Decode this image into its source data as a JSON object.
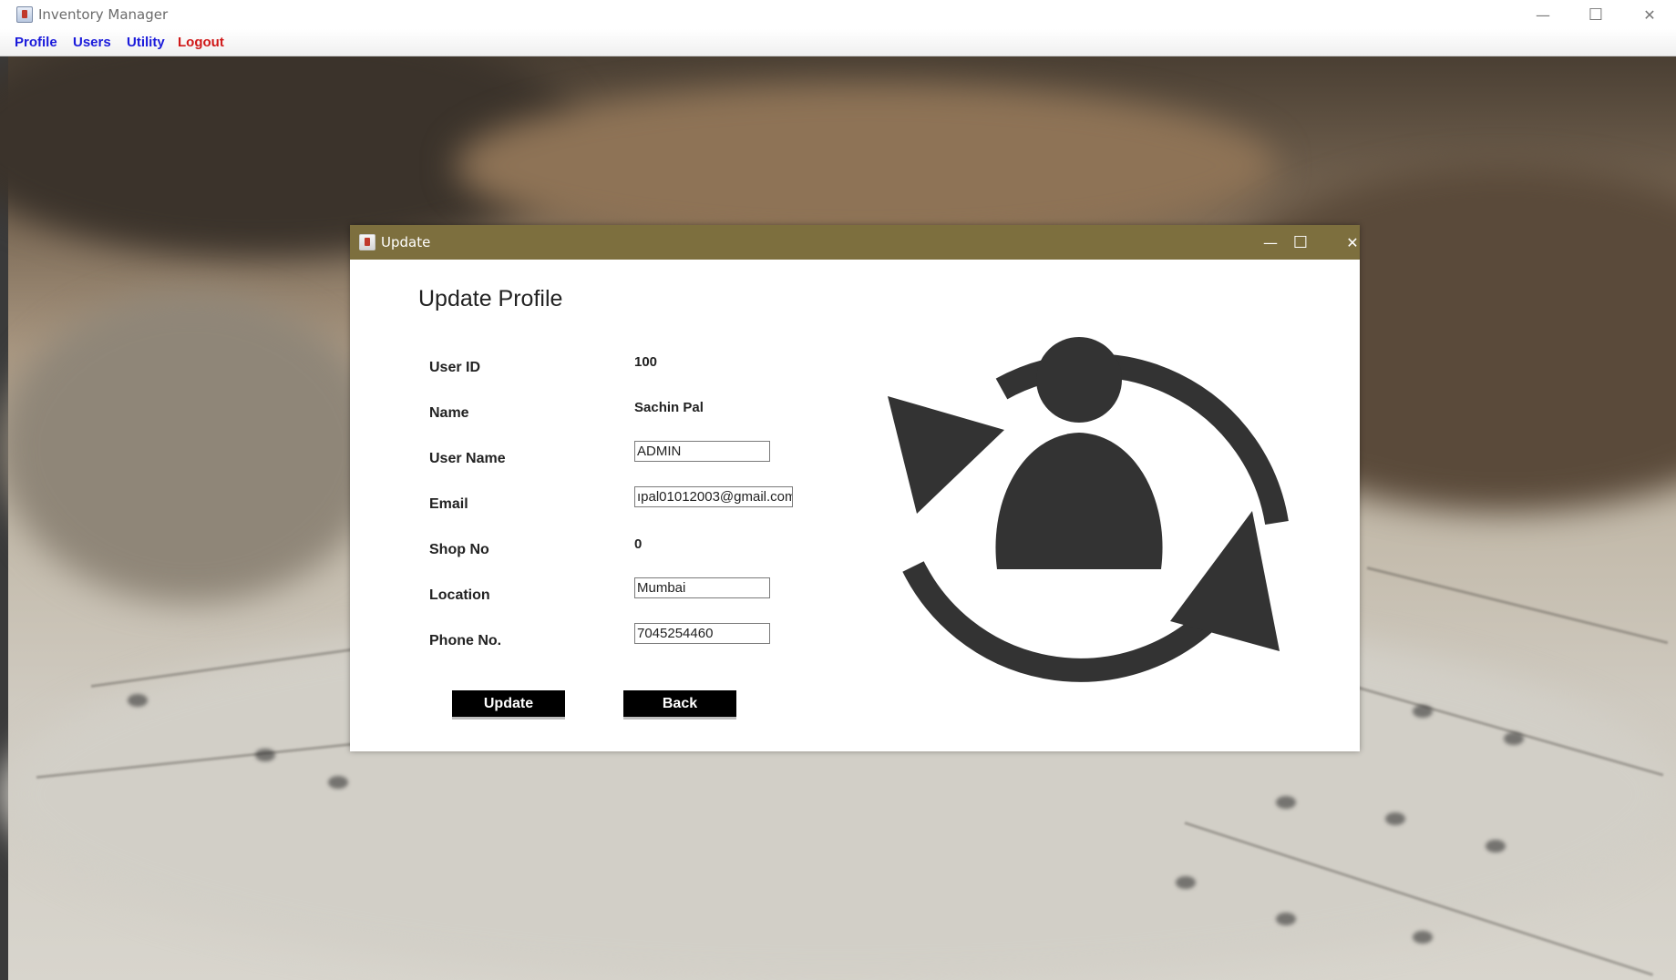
{
  "main_window": {
    "title": "Inventory Manager",
    "controls": {
      "minimize": "—",
      "maximize": "☐",
      "close": "✕"
    },
    "menu": [
      {
        "label": "Profile",
        "color": "#1a1adb"
      },
      {
        "label": "Users",
        "color": "#1a1adb"
      },
      {
        "label": "Utility",
        "color": "#1a1adb"
      },
      {
        "label": "Logout",
        "color": "#d01818"
      }
    ]
  },
  "dialog": {
    "title": "Update",
    "title_bar_color": "#7d6f3e",
    "controls": {
      "minimize": "—",
      "maximize": "☐",
      "close": "✕"
    },
    "heading": "Update Profile",
    "fields": {
      "user_id": {
        "label": "User ID",
        "value": "100"
      },
      "name": {
        "label": "Name",
        "value": "Sachin Pal"
      },
      "user_name": {
        "label": "User Name",
        "value": "ADMIN"
      },
      "email": {
        "label": "Email",
        "value": "ıpal01012003@gmail.com"
      },
      "shop_no": {
        "label": "Shop No",
        "value": "0"
      },
      "location": {
        "label": "Location",
        "value": "Mumbai"
      },
      "phone": {
        "label": "Phone No.",
        "value": "7045254460"
      }
    },
    "buttons": {
      "update": "Update",
      "back": "Back"
    },
    "graphic_icon": "user-refresh-icon"
  }
}
